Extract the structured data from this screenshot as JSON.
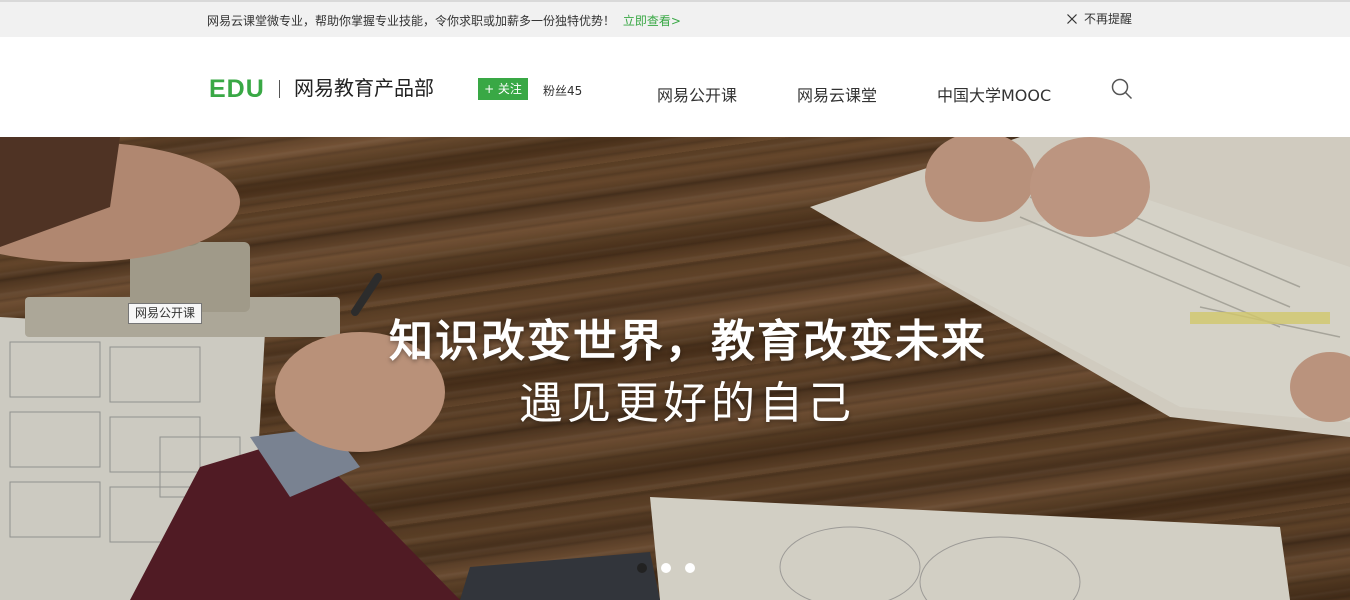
{
  "notice": {
    "text": "网易云课堂微专业，帮助你掌握专业技能，令你求职或加薪多一份独特优势！",
    "link_label": "立即查看>",
    "dismiss_label": "不再提醒"
  },
  "header": {
    "logo": "EDU",
    "site_name": "网易教育产品部",
    "follow_label": "+ 关注",
    "fans_label": "粉丝45",
    "nav": [
      {
        "label": "网易公开课"
      },
      {
        "label": "网易云课堂"
      },
      {
        "label": "中国大学MOOC"
      }
    ],
    "search_icon": "search-icon"
  },
  "banner": {
    "headline": "知识改变世界，教育改变未来",
    "subline": "遇见更好的自己",
    "tooltip": "网易公开课",
    "slides": 3,
    "active_slide": 1
  },
  "colors": {
    "accent": "#39a845",
    "notice_bg": "#f1f1f1",
    "text": "#333333"
  }
}
